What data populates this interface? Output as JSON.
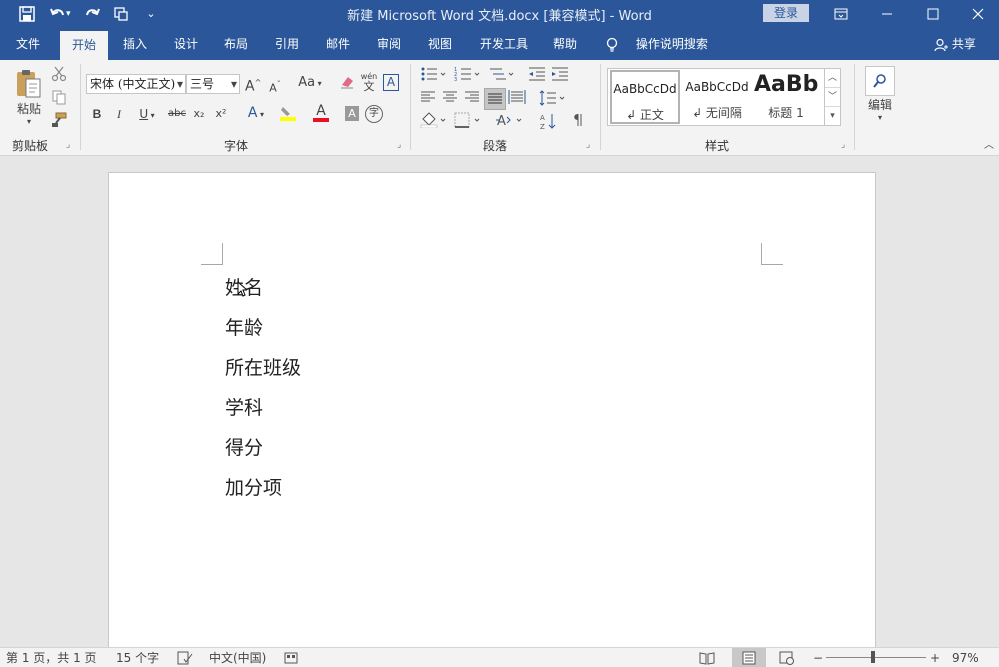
{
  "titlebar": {
    "title": "新建 Microsoft Word 文档.docx [兼容模式]  -  Word",
    "login_label": "登录"
  },
  "tabs": [
    {
      "label": "文件"
    },
    {
      "label": "开始"
    },
    {
      "label": "插入"
    },
    {
      "label": "设计"
    },
    {
      "label": "布局"
    },
    {
      "label": "引用"
    },
    {
      "label": "邮件"
    },
    {
      "label": "审阅"
    },
    {
      "label": "视图"
    },
    {
      "label": "开发工具"
    },
    {
      "label": "帮助"
    }
  ],
  "tell_me": "操作说明搜索",
  "share": "共享",
  "ribbon": {
    "clipboard": {
      "paste_label": "粘贴",
      "group_label": "剪贴板"
    },
    "font": {
      "font_name": "宋体 (中文正文)",
      "font_size": "三号",
      "grow": "A",
      "shrink": "A",
      "change_case": "Aa",
      "phonetic": "wén",
      "phonetic_char": "文",
      "border_char": "A",
      "bold": "B",
      "italic": "I",
      "underline": "U",
      "strike": "abc",
      "subscript": "x₂",
      "superscript": "x²",
      "text_effect": "A",
      "font_color": "A",
      "char_shading": "A",
      "enclose": "字",
      "group_label": "字体"
    },
    "paragraph": {
      "group_label": "段落"
    },
    "styles": {
      "items": [
        {
          "sample": "AaBbCcDd",
          "name": "↲ 正文"
        },
        {
          "sample": "AaBbCcDd",
          "name": "↲ 无间隔"
        },
        {
          "sample": "AaBb",
          "name": "标题 1"
        }
      ],
      "group_label": "样式"
    },
    "editing": {
      "label": "编辑"
    }
  },
  "document": {
    "lines": [
      "姓名",
      "年龄",
      "所在班级",
      "学科",
      "得分",
      "加分项"
    ]
  },
  "statusbar": {
    "page": "第 1 页，共 1 页",
    "words": "15 个字",
    "language": "中文(中国)",
    "zoom_minus": "−",
    "zoom_plus": "+",
    "zoom": "97%"
  },
  "colors": {
    "brand": "#2b579a",
    "highlight": "#ffff00",
    "font_color": "#e81123"
  }
}
